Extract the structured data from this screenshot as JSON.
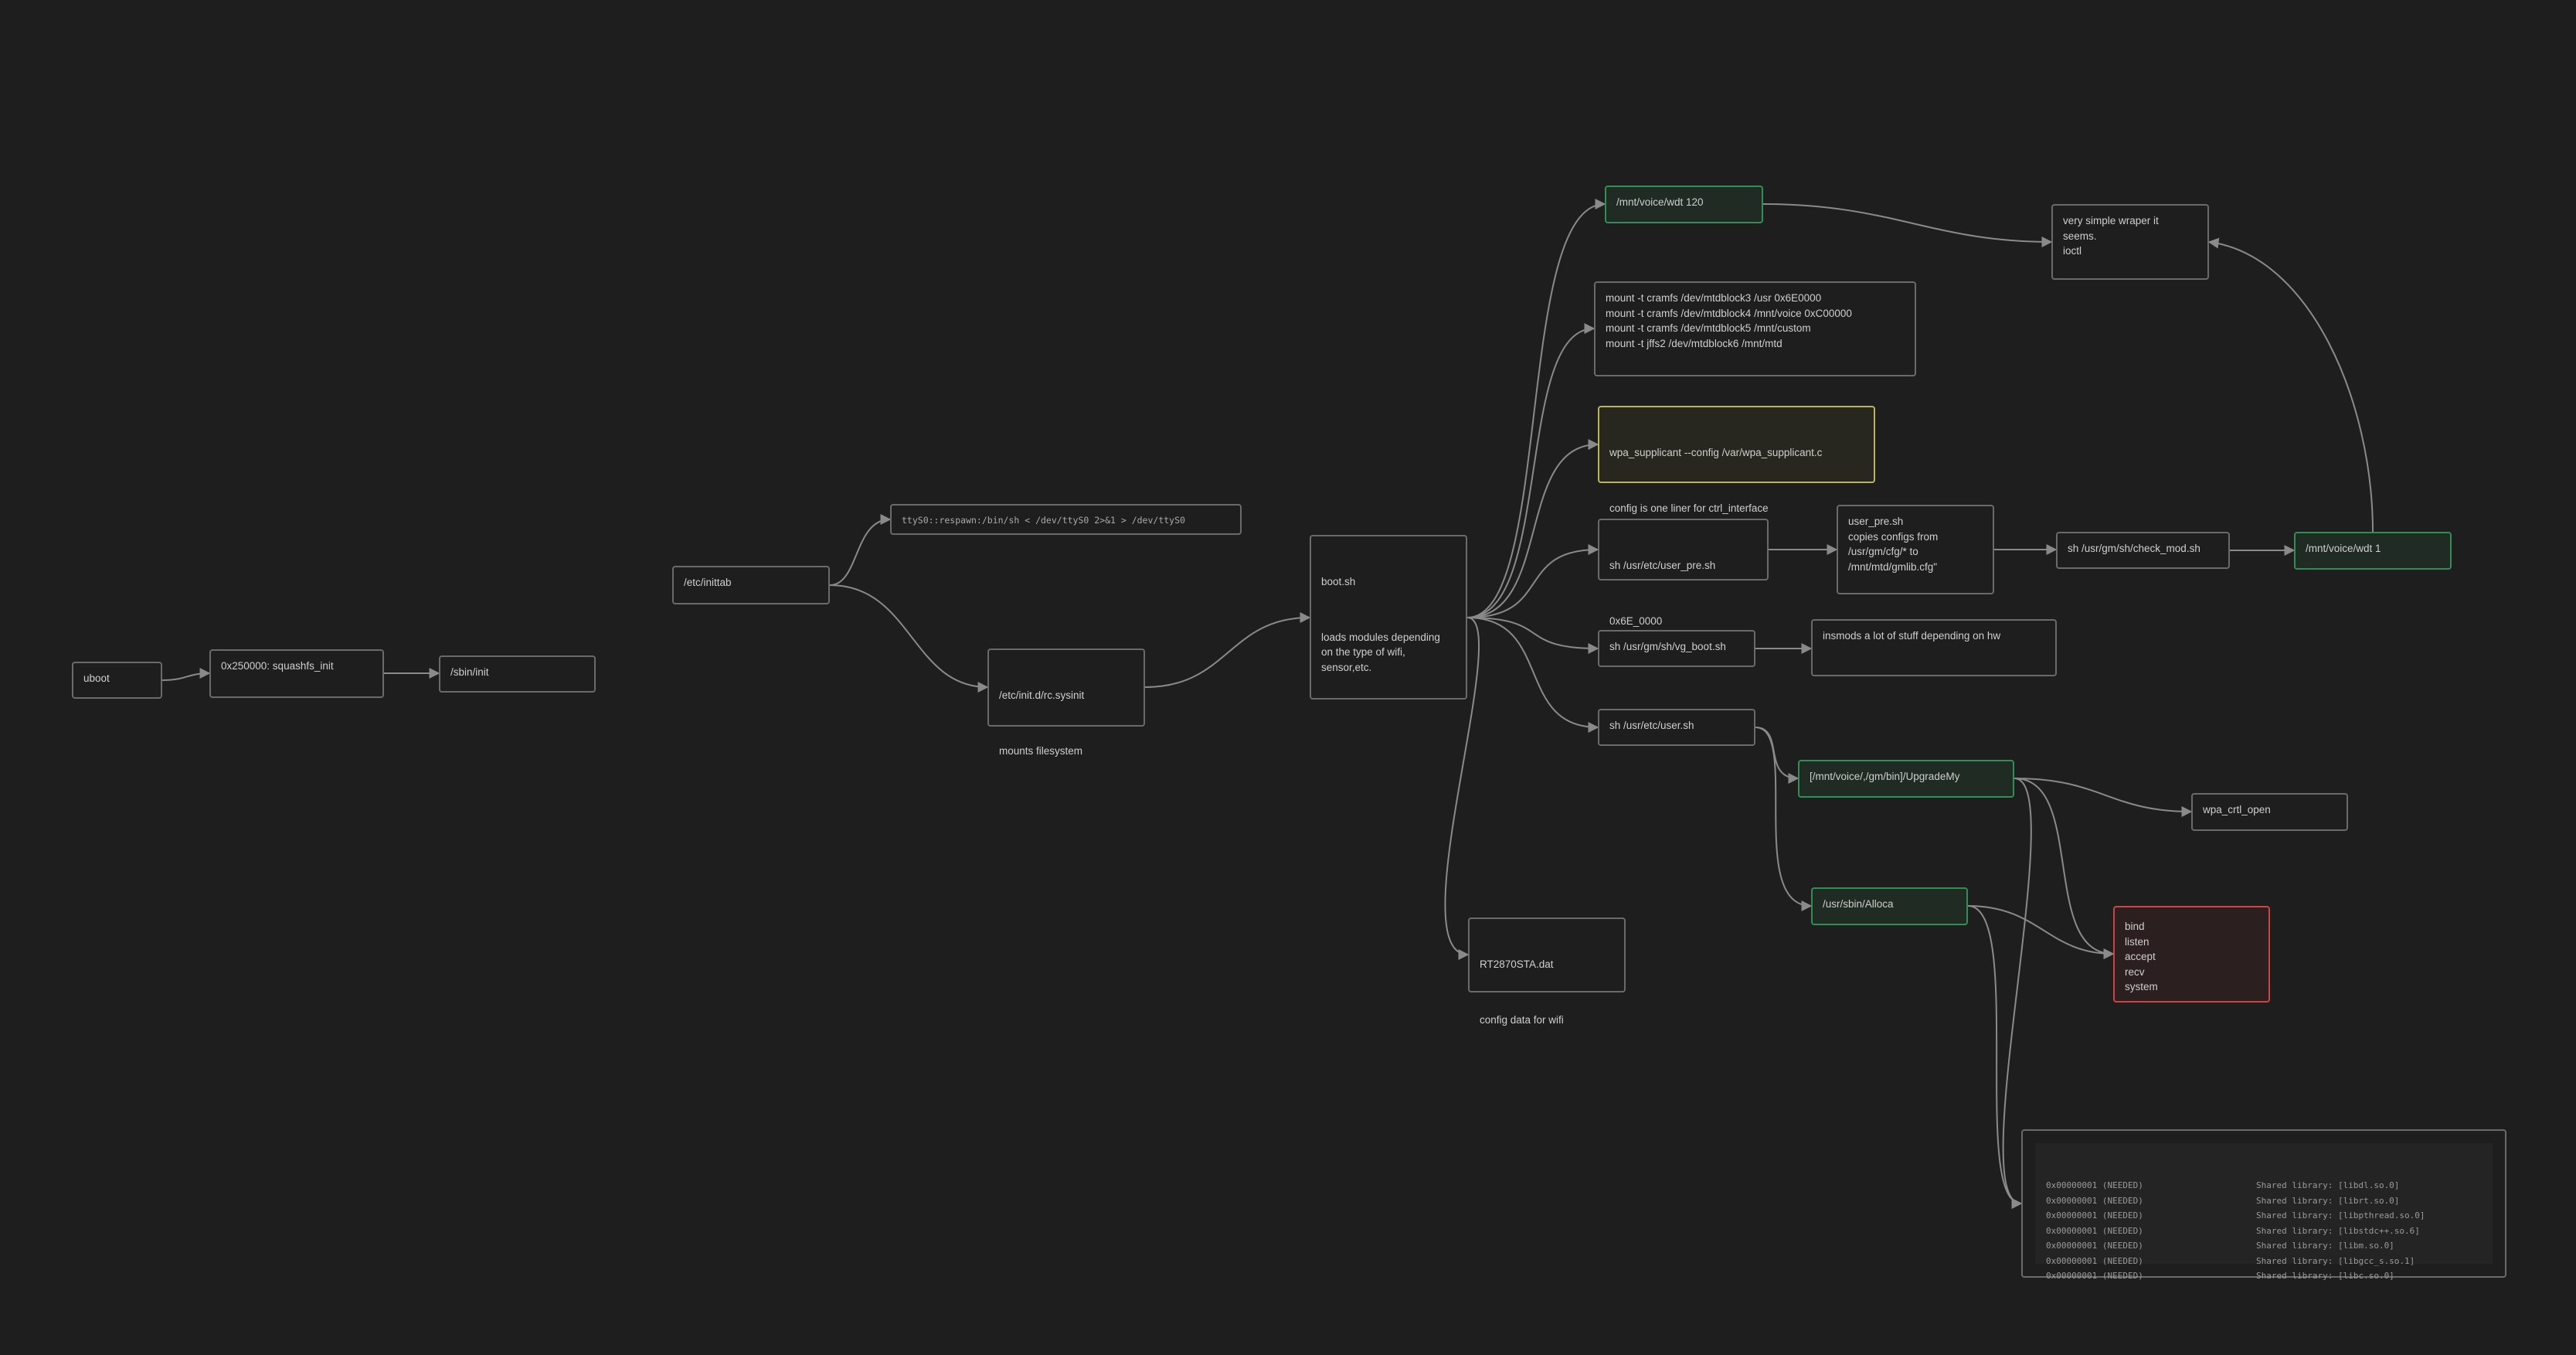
{
  "nodes": {
    "uboot": "uboot",
    "squashfs": "0x250000: squashfs_init",
    "sbin_init": "/sbin/init",
    "inittab": "/etc/inittab",
    "tty": "ttyS0::respawn:/bin/sh < /dev/ttyS0 2>&1 > /dev/ttyS0",
    "rcsysinit": [
      "/etc/init.d/rc.sysinit",
      "mounts filesystem"
    ],
    "bootsh": [
      "boot.sh",
      "loads modules depending\non the type of wifi,\nsensor,etc."
    ],
    "wdt120": "/mnt/voice/wdt 120",
    "mounts": "mount -t cramfs /dev/mtdblock3 /usr 0x6E0000\nmount -t cramfs /dev/mtdblock4 /mnt/voice 0xC00000\nmount -t cramfs /dev/mtdblock5 /mnt/custom\nmount -t jffs2 /dev/mtdblock6 /mnt/mtd",
    "wpa": [
      "wpa_supplicant --config /var/wpa_supplicant.c",
      "config is one liner for ctrl_interface"
    ],
    "userpre": [
      "sh /usr/etc/user_pre.sh",
      "0x6E_0000"
    ],
    "userpre_desc": "user_pre.sh\ncopies configs from\n/usr/gm/cfg/* to\n/mnt/mtd/gmlib.cfg\"",
    "checkmod": "sh /usr/gm/sh/check_mod.sh",
    "wdt1": "/mnt/voice/wdt 1",
    "wrapper": "very simple wraper it\nseems.\nioctl",
    "vgboot": "sh /usr/gm/sh/vg_boot.sh",
    "insmods": "insmods a lot of stuff depending on hw",
    "usersh": "sh /usr/etc/user.sh",
    "upgrade": "[/mnt/voice/,/gm/bin]/UpgradeMy",
    "wpactrl": "wpa_crtl_open",
    "alloca": "/usr/sbin/Alloca",
    "syscalls": "bind\nlisten\naccept\nrecv\nsystem",
    "rt2870": [
      "RT2870STA.dat",
      "config data for wifi"
    ]
  },
  "libraries": [
    {
      "tag": "0x00000001 (NEEDED)",
      "text": "Shared library: [libdl.so.0]"
    },
    {
      "tag": "0x00000001 (NEEDED)",
      "text": "Shared library: [librt.so.0]"
    },
    {
      "tag": "0x00000001 (NEEDED)",
      "text": "Shared library: [libpthread.so.0]"
    },
    {
      "tag": "0x00000001 (NEEDED)",
      "text": "Shared library: [libstdc++.so.6]"
    },
    {
      "tag": "0x00000001 (NEEDED)",
      "text": "Shared library: [libm.so.0]"
    },
    {
      "tag": "0x00000001 (NEEDED)",
      "text": "Shared library: [libgcc_s.so.1]"
    },
    {
      "tag": "0x00000001 (NEEDED)",
      "text": "Shared library: [libc.so.0]"
    }
  ],
  "colors": {
    "background": "#1e1e1e",
    "edge": "#8a8a8a",
    "border": "#6a6a6a",
    "green": "#2f8f55",
    "yellow": "#b9b55a",
    "red": "#cc4444"
  }
}
